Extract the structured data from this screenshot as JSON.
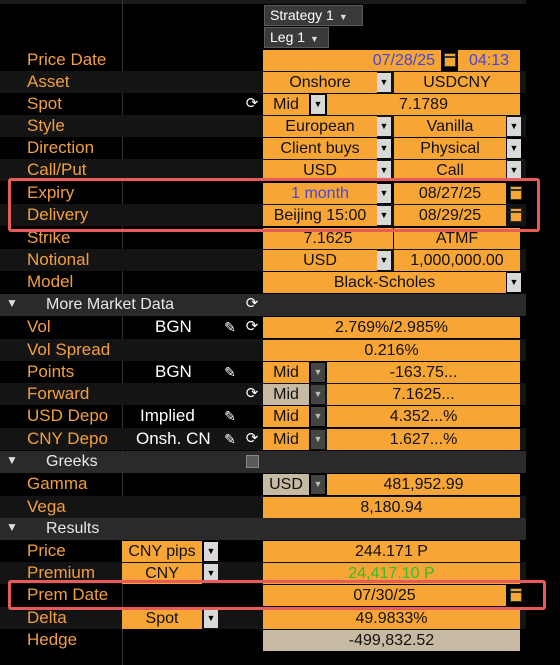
{
  "header": {
    "strategy": "Strategy 1",
    "leg": "Leg 1"
  },
  "rows": {
    "price_date": {
      "label": "Price Date",
      "date": "07/28/25",
      "time": "04:13"
    },
    "asset": {
      "label": "Asset",
      "type": "Onshore",
      "pair": "USDCNY"
    },
    "spot": {
      "label": "Spot",
      "side": "Mid",
      "value": "7.1789"
    },
    "style": {
      "label": "Style",
      "exercise": "European",
      "kind": "Vanilla"
    },
    "direction": {
      "label": "Direction",
      "side": "Client buys",
      "settle": "Physical"
    },
    "callput": {
      "label": "Call/Put",
      "ccy": "USD",
      "type": "Call"
    },
    "expiry": {
      "label": "Expiry",
      "tenor": "1 month",
      "date": "08/27/25"
    },
    "delivery": {
      "label": "Delivery",
      "cut": "Beijing 15:00",
      "date": "08/29/25"
    },
    "strike": {
      "label": "Strike",
      "value": "7.1625",
      "moneyness": "ATMF"
    },
    "notional": {
      "label": "Notional",
      "ccy": "USD",
      "value": "1,000,000.00"
    },
    "model": {
      "label": "Model",
      "value": "Black-Scholes"
    }
  },
  "market": {
    "title": "More Market Data",
    "vol": {
      "label": "Vol",
      "source": "BGN",
      "value": "2.769%/2.985%"
    },
    "vol_spread": {
      "label": "Vol Spread",
      "value": "0.216%"
    },
    "points": {
      "label": "Points",
      "source": "BGN",
      "side": "Mid",
      "value": "-163.75..."
    },
    "forward": {
      "label": "Forward",
      "side": "Mid",
      "value": "7.1625..."
    },
    "usd_depo": {
      "label": "USD Depo",
      "source": "Implied",
      "side": "Mid",
      "value": "4.352...%"
    },
    "cny_depo": {
      "label": "CNY Depo",
      "source": "Onsh. CN",
      "side": "Mid",
      "value": "1.627...%"
    }
  },
  "greeks": {
    "title": "Greeks",
    "gamma": {
      "label": "Gamma",
      "ccy": "USD",
      "value": "481,952.99"
    },
    "vega": {
      "label": "Vega",
      "value": "8,180.94"
    }
  },
  "results": {
    "title": "Results",
    "price": {
      "label": "Price",
      "unit": "CNY pips",
      "value": "244.171 P"
    },
    "premium": {
      "label": "Premium",
      "ccy": "CNY",
      "value": "24,417.10 P"
    },
    "prem_date": {
      "label": "Prem Date",
      "value": "07/30/25"
    },
    "delta": {
      "label": "Delta",
      "type": "Spot",
      "value": "49.9833%"
    },
    "hedge": {
      "label": "Hedge",
      "value": "-499,832.52"
    }
  },
  "colors": {
    "cell": "#f7a535",
    "label": "#f2a03d",
    "highlight": "#e85b5b",
    "expiry_text": "#4646d6",
    "premium_text": "#2fbf2f"
  }
}
